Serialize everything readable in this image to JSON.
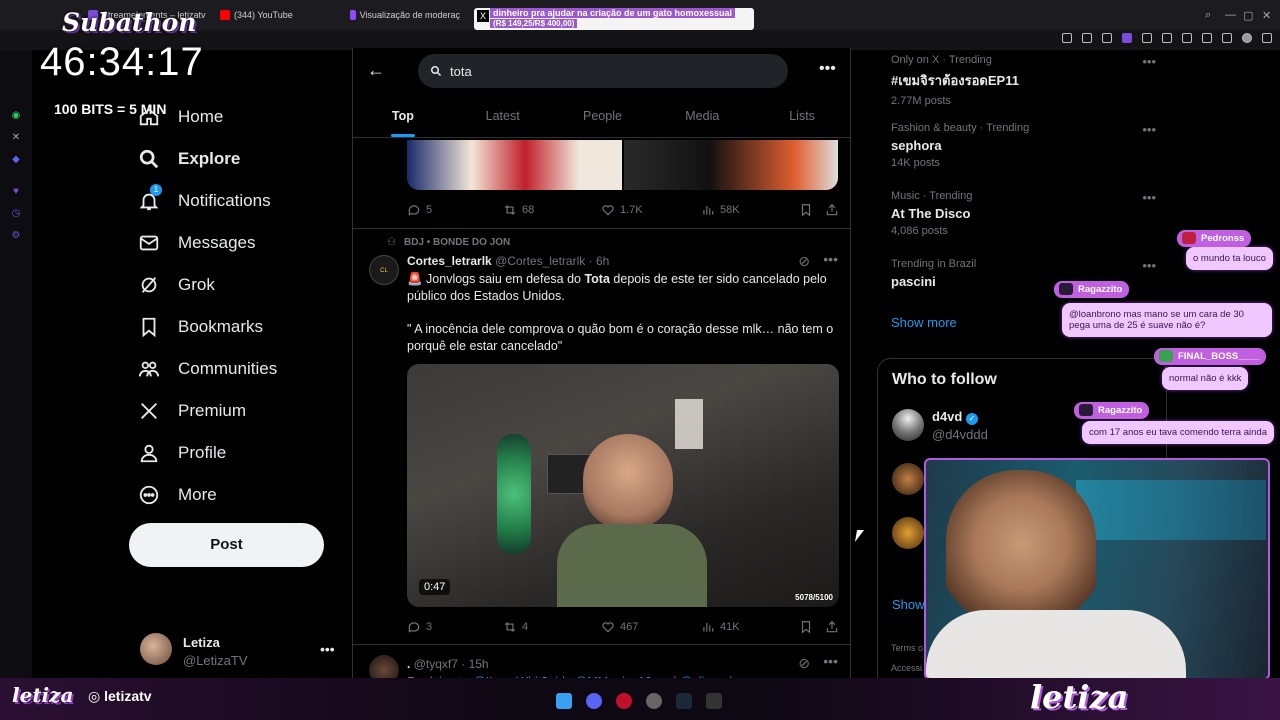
{
  "browser": {
    "tabs": [
      {
        "label": "Streamelements – letizatv",
        "color": "#7a4bd6"
      },
      {
        "label": "(344) YouTube",
        "color": "#ff0000"
      },
      {
        "label": "Visualização de moderaç",
        "color": "#9146ff"
      }
    ]
  },
  "stream": {
    "subathon_title": "Subathon",
    "timer": "46:34:17",
    "bits_rule": "100 BITS = 5 MIN",
    "alert_line1": "dinheiro pra ajudar na criação de um gato homoxessual",
    "alert_line2": "(R$ 149,25/R$ 400,00)",
    "logo_left": "letiza",
    "instagram_left": "letizatv",
    "logo_right": "letiza",
    "chat": [
      {
        "user": "Pedronss",
        "message": "o mundo ta louco"
      },
      {
        "user": "Ragazzito",
        "message": "@loanbrono mas mano se um cara de 30 pega uma de 25 é suave não é?"
      },
      {
        "user": "FINAL_BOSS____",
        "message": "normal não é kkk"
      },
      {
        "user": "Ragazzito",
        "message": "com 17 anos eu tava comendo terra ainda"
      }
    ]
  },
  "nav": {
    "items": [
      {
        "label": "Home",
        "icon": "home-icon"
      },
      {
        "label": "Explore",
        "icon": "search-icon"
      },
      {
        "label": "Notifications",
        "icon": "bell-icon",
        "badge": "1"
      },
      {
        "label": "Messages",
        "icon": "mail-icon"
      },
      {
        "label": "Grok",
        "icon": "grok-icon"
      },
      {
        "label": "Bookmarks",
        "icon": "bookmark-icon"
      },
      {
        "label": "Communities",
        "icon": "communities-icon"
      },
      {
        "label": "Premium",
        "icon": "x-logo-icon"
      },
      {
        "label": "Profile",
        "icon": "person-icon"
      },
      {
        "label": "More",
        "icon": "more-circle-icon"
      }
    ],
    "post_label": "Post",
    "account": {
      "name": "Letiza",
      "handle": "@LetizaTV"
    }
  },
  "search": {
    "query": "tota",
    "tabs": [
      "Top",
      "Latest",
      "People",
      "Media",
      "Lists"
    ],
    "active_tab": "Top"
  },
  "tweets": [
    {
      "stats": {
        "replies": "5",
        "retweets": "68",
        "likes": "1.7K",
        "views": "58K"
      }
    },
    {
      "context": "BDJ • BONDE DO JON",
      "name": "Cortes_letrarlk",
      "handle": "@Cortes_letrarlk",
      "time": "· 6h",
      "text_pre": "🚨 Jonvlogs saiu em defesa do ",
      "text_bold": "Tota",
      "text_post": " depois de este ter sido cancelado pelo público dos Estados Unidos.",
      "quote": "\" A inocência dele comprova o quão bom é o coração desse mlk… não tem o porquê ele estar cancelado\"",
      "video_duration": "0:47",
      "video_counter": "5078/5100",
      "stats": {
        "replies": "3",
        "retweets": "4",
        "likes": "467",
        "views": "41K"
      }
    },
    {
      "name": ".",
      "handle": "@tyqxf7",
      "time": "· 15h",
      "reply_prefix": "Replying to",
      "reply_to": "@ILoveWhit3girls @MMagico10 and @clippedszn"
    }
  ],
  "trends": [
    {
      "context": "Only on X · Trending",
      "name": "#เขมจิราต้องรอดEP11",
      "count": "2.77M posts"
    },
    {
      "context": "Fashion & beauty · Trending",
      "name": "sephora",
      "count": "14K posts"
    },
    {
      "context": "Music · Trending",
      "name": "At The Disco",
      "count": "4,086 posts"
    },
    {
      "context": "Trending in Brazil",
      "name": "pascini",
      "count": ""
    }
  ],
  "show_more": "Show more",
  "who_to_follow": {
    "title": "Who to follow",
    "first": {
      "name": "d4vd",
      "handle": "@d4vddd"
    },
    "show_more": "Show",
    "footer": "Terms o",
    "footer2": "Accessi"
  },
  "colors": {
    "accent": "#1d9bf0",
    "stream": "#b05ae0"
  }
}
